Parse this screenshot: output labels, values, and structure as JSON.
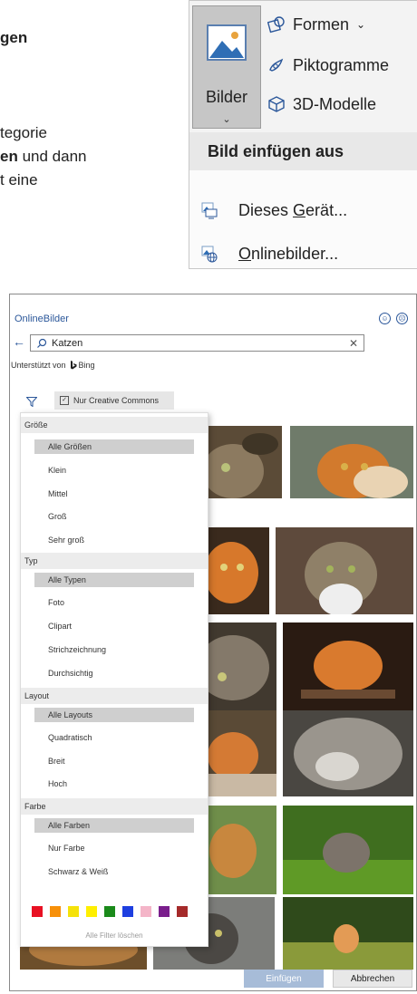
{
  "left_text": {
    "line1": "gen",
    "line2": "tegorie",
    "line3_bold": "en",
    "line3_rest": " und dann",
    "line4": "t eine"
  },
  "ribbon": {
    "bilder_label": "Bilder",
    "bilder_caret": "⌄",
    "formen_label": "Formen",
    "formen_caret": "⌄",
    "piktogramme_label": "Piktogramme",
    "modelle_label": "3D-Modelle"
  },
  "insert_menu": {
    "header": "Bild einfügen aus",
    "device_pre": "Dieses ",
    "device_u": "G",
    "device_post": "erät...",
    "online_u": "O",
    "online_post": "nlinebilder..."
  },
  "dialog": {
    "title": "OnlineBilder",
    "search_value": "Katzen",
    "powered_by": "Unterstützt von",
    "bing": "Bing",
    "creative_commons": "Nur Creative Commons",
    "filters": {
      "size": {
        "header": "Größe",
        "options": [
          "Alle Größen",
          "Klein",
          "Mittel",
          "Groß",
          "Sehr groß"
        ],
        "selected": "Alle Größen"
      },
      "type": {
        "header": "Typ",
        "options": [
          "Alle Typen",
          "Foto",
          "Clipart",
          "Strichzeichnung",
          "Durchsichtig"
        ],
        "selected": "Alle Typen"
      },
      "layout": {
        "header": "Layout",
        "options": [
          "Alle Layouts",
          "Quadratisch",
          "Breit",
          "Hoch"
        ],
        "selected": "Alle Layouts"
      },
      "color": {
        "header": "Farbe",
        "options": [
          "Alle Farben",
          "Nur Farbe",
          "Schwarz & Weiß"
        ],
        "selected": "Alle Farben"
      }
    },
    "color_swatches": [
      "#e81123",
      "#f7900a",
      "#f5e20a",
      "#ffef00",
      "#1a8a1a",
      "#1e3fe0",
      "#f4b5c8",
      "#7a1e8c",
      "#a52a2a"
    ],
    "clear_filters": "Alle Filter löschen",
    "insert_button": "Einfügen",
    "cancel_button": "Abbrechen"
  },
  "colors": {
    "accent": "#2b579a",
    "ribbon_bg": "#f3f3f3",
    "selected_option": "#cfcfcf",
    "insert_button_bg": "#a7bcd8"
  }
}
